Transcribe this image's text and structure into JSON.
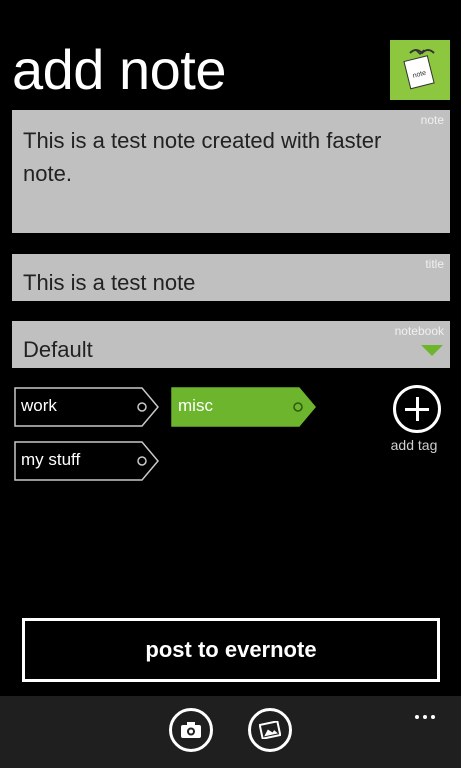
{
  "page": {
    "title": "add note"
  },
  "app_icon": {
    "name": "note-app-icon",
    "text": "note"
  },
  "note_field": {
    "corner_label": "note",
    "value": "This is a test note created with faster note."
  },
  "title_field": {
    "corner_label": "title",
    "value": "This is a test note"
  },
  "notebook_field": {
    "corner_label": "notebook",
    "value": "Default"
  },
  "tags": [
    {
      "label": "work",
      "selected": false
    },
    {
      "label": "misc",
      "selected": true
    },
    {
      "label": "my stuff",
      "selected": false
    }
  ],
  "add_tag": {
    "label": "add tag",
    "icon": "plus-circle-icon"
  },
  "post_button": {
    "label": "post to evernote"
  },
  "app_bar": {
    "buttons": [
      {
        "icon": "camera-icon"
      },
      {
        "icon": "photo-library-icon"
      }
    ],
    "more_icon": "ellipsis-icon"
  },
  "colors": {
    "accent": "#6cb52d",
    "field_bg": "#c0c0c0",
    "background": "#000000",
    "app_bar": "#1f1f1f"
  }
}
